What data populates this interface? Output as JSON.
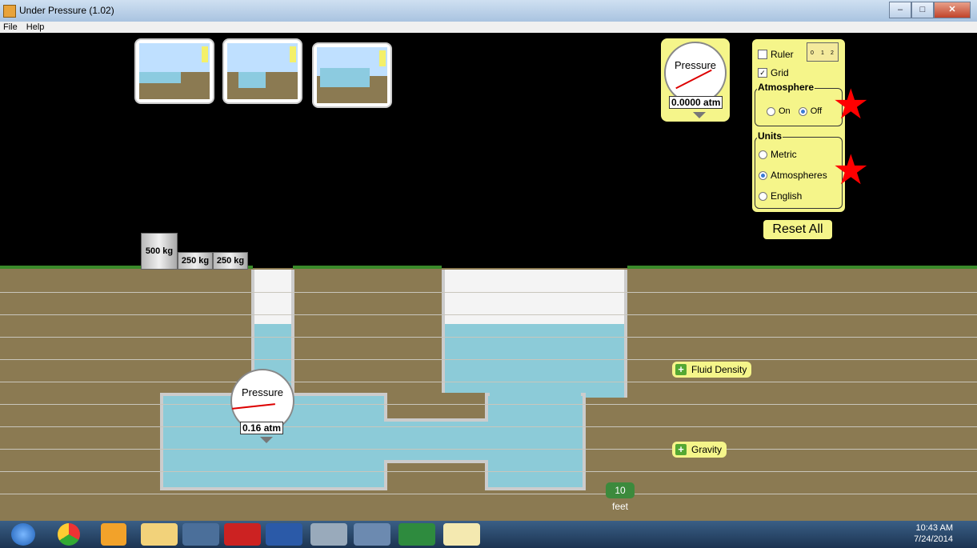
{
  "window": {
    "title": "Under Pressure (1.02)"
  },
  "menu": [
    "File",
    "Help"
  ],
  "scene_thumbnails": [
    "pool-scene-1",
    "pool-scene-2",
    "pool-scene-3"
  ],
  "top_gauge": {
    "label": "Pressure",
    "value": "0.0000 atm"
  },
  "controls": {
    "ruler_label": "Ruler",
    "ruler_checked": false,
    "ruler_ticks": [
      "0",
      "1",
      "2"
    ],
    "grid_label": "Grid",
    "grid_checked": true,
    "atmosphere": {
      "title": "Atmosphere",
      "options": [
        "On",
        "Off"
      ],
      "selected": "Off"
    },
    "units": {
      "title": "Units",
      "options": [
        "Metric",
        "Atmospheres",
        "English"
      ],
      "selected": "Atmospheres"
    }
  },
  "reset_label": "Reset All",
  "weights": [
    "500 kg",
    "250 kg",
    "250 kg"
  ],
  "pool_gauge": {
    "label": "Pressure",
    "value": "0.16 atm"
  },
  "fluid_density_label": "Fluid Density",
  "gravity_label": "Gravity",
  "measure_label": "10 feet",
  "taskbar": {
    "time": "10:43 AM",
    "date": "7/24/2014"
  },
  "colors": {
    "panel": "#f5f58a",
    "water": "#8ccbd8",
    "ground": "#8b7a52",
    "grass": "#3a8a2a",
    "marker": "#ff0000"
  }
}
